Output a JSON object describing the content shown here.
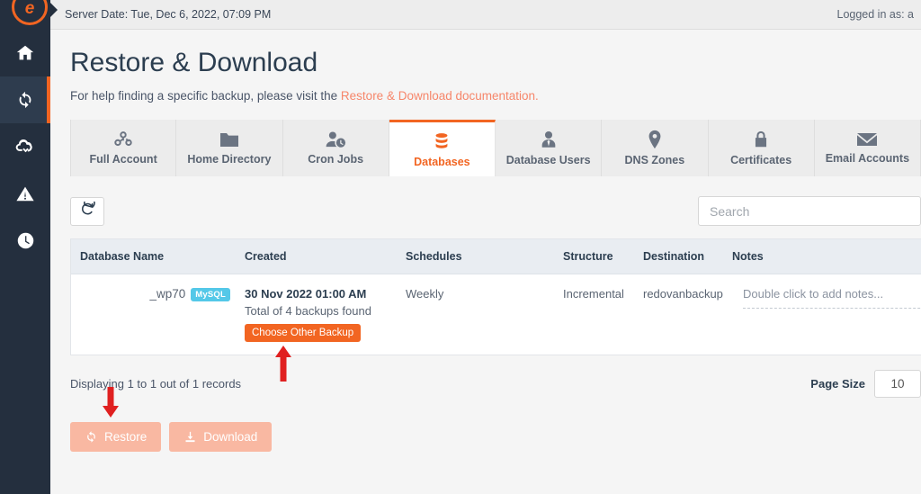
{
  "topbar": {
    "server_date": "Server Date: Tue, Dec 6, 2022, 07:09 PM",
    "logged_in_as": "Logged in as: a"
  },
  "sidebar": {
    "logo_glyph": "e",
    "items": [
      {
        "name": "home",
        "icon": "home-icon",
        "active": false
      },
      {
        "name": "restore",
        "icon": "sync-icon",
        "active": true
      },
      {
        "name": "backup",
        "icon": "cloud-download-icon",
        "active": false
      },
      {
        "name": "alerts",
        "icon": "warning-icon",
        "active": false
      },
      {
        "name": "history",
        "icon": "clock-icon",
        "active": false
      }
    ]
  },
  "page": {
    "title": "Restore & Download",
    "subtitle_prefix": "For help finding a specific backup, please visit the ",
    "subtitle_link": "Restore & Download documentation.",
    "link_color": "#f6866a"
  },
  "tabs": [
    {
      "label": "Full Account",
      "icon": "cubes-icon",
      "active": false
    },
    {
      "label": "Home Directory",
      "icon": "folder-icon",
      "active": false
    },
    {
      "label": "Cron Jobs",
      "icon": "user-clock-icon",
      "active": false
    },
    {
      "label": "Databases",
      "icon": "database-icon",
      "active": true
    },
    {
      "label": "Database Users",
      "icon": "user-tie-icon",
      "active": false
    },
    {
      "label": "DNS Zones",
      "icon": "map-pin-icon",
      "active": false
    },
    {
      "label": "Certificates",
      "icon": "lock-icon",
      "active": false
    },
    {
      "label": "Email Accounts",
      "icon": "envelope-icon",
      "active": false
    }
  ],
  "toolbar": {
    "refresh_icon": "refresh-icon",
    "search_placeholder": "Search",
    "search_value": ""
  },
  "table": {
    "columns": [
      "Database Name",
      "Created",
      "Schedules",
      "Structure",
      "Destination",
      "Notes"
    ],
    "rows": [
      {
        "database_name": "_wp70",
        "engine_badge": "MySQL",
        "created_date": "30 Nov 2022 01:00 AM",
        "backups_found": "Total of 4 backups found",
        "choose_other_label": "Choose Other Backup",
        "schedule": "Weekly",
        "structure": "Incremental",
        "destination": "redovanbackup",
        "notes_placeholder": "Double click to add notes..."
      }
    ]
  },
  "footer": {
    "records_text": "Displaying 1 to 1 out of 1 records",
    "page_size_label": "Page Size",
    "page_size_value": "10"
  },
  "actions": [
    {
      "label": "Restore",
      "icon": "sync-icon",
      "disabled": true
    },
    {
      "label": "Download",
      "icon": "download-icon",
      "disabled": true
    }
  ],
  "annotations": {
    "arrow_color": "#e02020",
    "arrow_up_target": "choose-other-backup-button",
    "arrow_down_target": "restore-button"
  }
}
